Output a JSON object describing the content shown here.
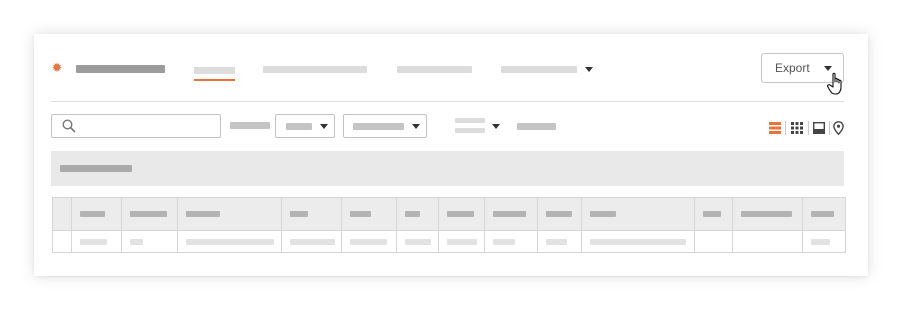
{
  "header": {
    "app_icon": "gear-icon",
    "export_label": "Export"
  },
  "colors": {
    "accent": "#e8743b",
    "placeholder_bar": "#c4c4c4",
    "group_bar_bg": "#e9e9e9",
    "table_header_bg": "#ececec"
  },
  "toolbar": {
    "view_icons": [
      "list-view-icon",
      "grid-view-icon",
      "gallery-view-icon",
      "map-view-icon"
    ]
  }
}
